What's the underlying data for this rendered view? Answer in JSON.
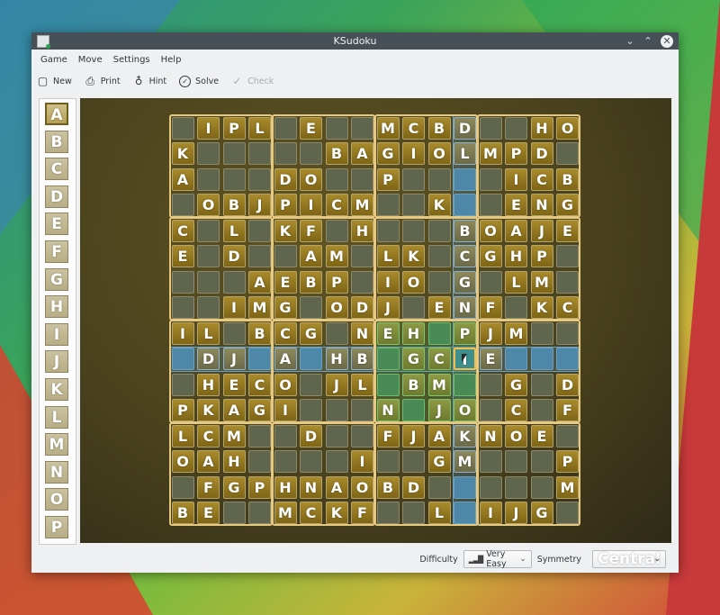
{
  "window": {
    "title": "KSudoku",
    "controls": {
      "minimize": "⌄",
      "maximize": "⌃",
      "close": "✕"
    }
  },
  "menubar": [
    "Game",
    "Move",
    "Settings",
    "Help"
  ],
  "toolbar": [
    {
      "label": "New",
      "icon": "new-document-icon",
      "glyph": "▢",
      "enabled": true
    },
    {
      "label": "Print",
      "icon": "printer-icon",
      "glyph": "⎙",
      "enabled": true
    },
    {
      "label": "Hint",
      "icon": "lightbulb-icon",
      "glyph": "♁",
      "enabled": true
    },
    {
      "label": "Solve",
      "icon": "check-circle-icon",
      "glyph": "✓",
      "enabled": true
    },
    {
      "label": "Check",
      "icon": "checkmark-icon",
      "glyph": "✓",
      "enabled": false
    }
  ],
  "symbols": {
    "items": [
      "A",
      "B",
      "C",
      "D",
      "E",
      "F",
      "G",
      "H",
      "I",
      "J",
      "K",
      "L",
      "M",
      "N",
      "O",
      "P"
    ],
    "selected": "A"
  },
  "board": {
    "size": 16,
    "block": 4,
    "selected": {
      "row": 9,
      "col": 11
    },
    "rows": [
      [
        "",
        "I",
        "P",
        "L",
        "",
        "E",
        "",
        "",
        "M",
        "C",
        "B",
        "D",
        "",
        "",
        "H",
        "O"
      ],
      [
        "K",
        "",
        "",
        "",
        "",
        "",
        "B",
        "A",
        "G",
        "I",
        "O",
        "L",
        "M",
        "P",
        "D",
        ""
      ],
      [
        "A",
        "",
        "",
        "",
        "D",
        "O",
        "",
        "",
        "P",
        "",
        "",
        "",
        "",
        "I",
        "C",
        "B"
      ],
      [
        "",
        "O",
        "B",
        "J",
        "P",
        "I",
        "C",
        "M",
        "",
        "",
        "K",
        "",
        "",
        "E",
        "N",
        "G"
      ],
      [
        "C",
        "",
        "L",
        "",
        "K",
        "F",
        "",
        "H",
        "",
        "",
        "",
        "B",
        "O",
        "A",
        "J",
        "E"
      ],
      [
        "E",
        "",
        "D",
        "",
        "",
        "A",
        "M",
        "",
        "L",
        "K",
        "",
        "C",
        "G",
        "H",
        "P",
        ""
      ],
      [
        "",
        "",
        "",
        "A",
        "E",
        "B",
        "P",
        "",
        "I",
        "O",
        "",
        "G",
        "",
        "L",
        "M",
        ""
      ],
      [
        "",
        "",
        "I",
        "M",
        "G",
        "",
        "O",
        "D",
        "J",
        "",
        "E",
        "N",
        "F",
        "",
        "K",
        "C"
      ],
      [
        "I",
        "L",
        "",
        "B",
        "C",
        "G",
        "",
        "N",
        "E",
        "H",
        "",
        "P",
        "J",
        "M",
        "",
        ""
      ],
      [
        "",
        "D",
        "J",
        "",
        "A",
        "",
        "H",
        "B",
        "",
        "G",
        "C",
        "I",
        "E",
        "",
        "",
        ""
      ],
      [
        "",
        "H",
        "E",
        "C",
        "O",
        "",
        "J",
        "L",
        "",
        "B",
        "M",
        "",
        "",
        "G",
        "",
        "D"
      ],
      [
        "P",
        "K",
        "A",
        "G",
        "I",
        "",
        "",
        "",
        "N",
        "",
        "J",
        "O",
        "",
        "C",
        "",
        "F"
      ],
      [
        "L",
        "C",
        "M",
        "",
        "",
        "D",
        "",
        "",
        "F",
        "J",
        "A",
        "K",
        "N",
        "O",
        "E",
        ""
      ],
      [
        "O",
        "A",
        "H",
        "",
        "",
        "",
        "",
        "I",
        "",
        "",
        "G",
        "M",
        "",
        "",
        "",
        "P"
      ],
      [
        "",
        "F",
        "G",
        "P",
        "H",
        "N",
        "A",
        "O",
        "B",
        "D",
        "",
        "",
        "",
        "",
        "",
        "M"
      ],
      [
        "B",
        "E",
        "",
        "",
        "M",
        "C",
        "K",
        "F",
        "",
        "",
        "L",
        "",
        "I",
        "J",
        "G",
        ""
      ]
    ]
  },
  "bottom": {
    "difficulty_label": "Difficulty",
    "difficulty_value": "Very Easy",
    "symmetry_label": "Symmetry",
    "symmetry_value": "Central"
  }
}
